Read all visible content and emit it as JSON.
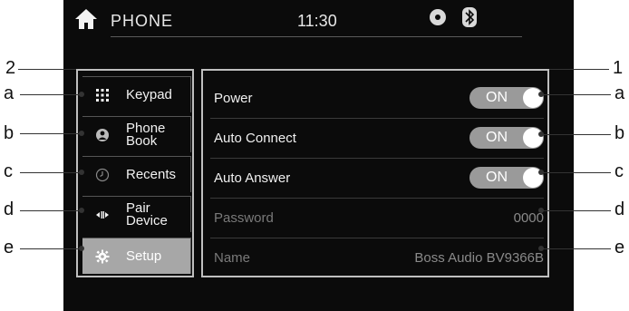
{
  "header": {
    "title": "PHONE",
    "time": "11:30",
    "icons": [
      "home-icon",
      "disc-icon",
      "bluetooth-icon"
    ]
  },
  "sidebar": {
    "items": [
      {
        "label": "Keypad",
        "icon": "keypad-icon"
      },
      {
        "label": "Phone\nBook",
        "icon": "phonebook-icon"
      },
      {
        "label": "Recents",
        "icon": "clock-icon"
      },
      {
        "label": "Pair\nDevice",
        "icon": "pair-icon"
      },
      {
        "label": "Setup",
        "icon": "gear-icon",
        "active": true
      }
    ]
  },
  "settings": {
    "rows": [
      {
        "label": "Power",
        "toggle": "ON"
      },
      {
        "label": "Auto Connect",
        "toggle": "ON"
      },
      {
        "label": "Auto Answer",
        "toggle": "ON"
      },
      {
        "label": "Password",
        "value": "0000"
      },
      {
        "label": "Name",
        "value": "Boss Audio BV9366B"
      }
    ]
  },
  "callouts": {
    "left_group": "2",
    "right_group": "1",
    "letters": [
      "a",
      "b",
      "c",
      "d",
      "e"
    ]
  }
}
